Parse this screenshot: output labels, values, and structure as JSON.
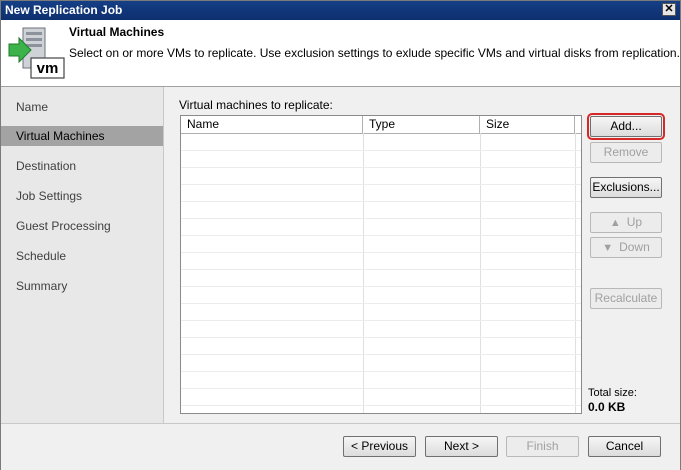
{
  "window": {
    "title": "New Replication Job",
    "close_glyph": "✕"
  },
  "header": {
    "title": "Virtual Machines",
    "description": "Select on or more VMs to replicate. Use exclusion settings to exlude specific VMs and virtual disks from replication.",
    "icon_text": "vm"
  },
  "sidebar": {
    "items": [
      {
        "label": "Name",
        "active": false
      },
      {
        "label": "Virtual Machines",
        "active": true
      },
      {
        "label": "Destination",
        "active": false
      },
      {
        "label": "Job Settings",
        "active": false
      },
      {
        "label": "Guest Processing",
        "active": false
      },
      {
        "label": "Schedule",
        "active": false
      },
      {
        "label": "Summary",
        "active": false
      }
    ]
  },
  "main": {
    "list_label": "Virtual machines to replicate:",
    "columns": [
      "Name",
      "Type",
      "Size"
    ],
    "rows": []
  },
  "actions": {
    "add": "Add...",
    "remove": "Remove",
    "exclusions": "Exclusions...",
    "up": "Up",
    "down": "Down",
    "recalculate": "Recalculate"
  },
  "total": {
    "label": "Total size:",
    "value": "0.0 KB"
  },
  "footer": {
    "previous": "< Previous",
    "next": "Next >",
    "finish": "Finish",
    "cancel": "Cancel"
  },
  "colors": {
    "highlight": "#d62828",
    "titlebar": "#153f86",
    "active_step": "#a3a3a3"
  }
}
